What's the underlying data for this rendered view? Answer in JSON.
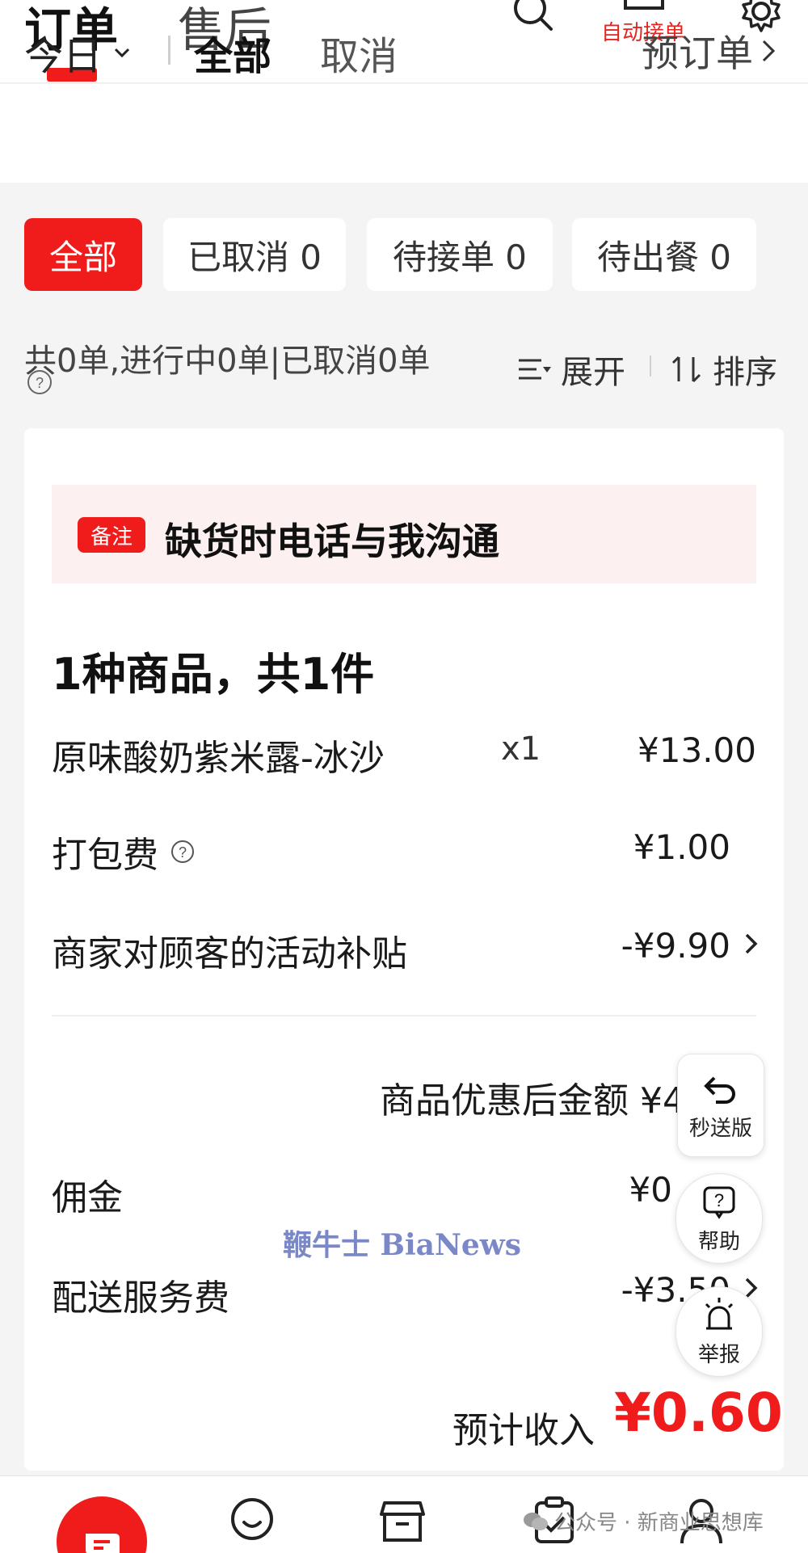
{
  "header": {
    "tabs": [
      "订单",
      "售后"
    ],
    "active_tab": "订单",
    "auto_accept_label": "自动接单",
    "icons": [
      "search-icon",
      "store-icon",
      "gear-icon"
    ],
    "accent_color": "#f01c1c"
  },
  "filter_bar": {
    "date_label": "今日",
    "options": [
      "全部",
      "取消"
    ],
    "active_option": "全部",
    "preorder_label": "预订单"
  },
  "status_chips": [
    {
      "label": "全部",
      "active": true
    },
    {
      "label": "已取消 0",
      "active": false
    },
    {
      "label": "待接单 0",
      "active": false
    },
    {
      "label": "待出餐 0",
      "active": false
    }
  ],
  "summary": {
    "text": "共0单,进行中0单|已取消0单",
    "expand_label": "展开",
    "sort_label": "排序"
  },
  "order": {
    "note_badge": "备注",
    "note_text": "缺货时电话与我沟通",
    "goods_heading": "1种商品，共1件",
    "item_name": "原味酸奶紫米露-冰沙",
    "item_qty": "x1",
    "item_price": "¥13.00",
    "packing_fee_label": "打包费",
    "packing_fee_value": "¥1.00",
    "merchant_subsidy_label": "商家对顾客的活动补贴",
    "merchant_subsidy_value": "-¥9.90",
    "discounted_total": "商品优惠后金额 ¥4.10",
    "commission_label": "佣金",
    "commission_value": "¥0",
    "delivery_fee_label": "配送服务费",
    "delivery_fee_value": "-¥3.50",
    "est_income_label": "预计收入",
    "est_income_value": "¥0.60"
  },
  "floating": {
    "express_label": "秒送版",
    "help_label": "帮助",
    "report_label": "举报"
  },
  "watermarks": {
    "bianews": "鞭牛士 BiaNews",
    "wechat": "公众号 · 新商业思想库"
  },
  "bottom_nav": {
    "icons": [
      "orders-icon",
      "chat-icon",
      "shop-icon",
      "clipboard-icon",
      "profile-icon"
    ]
  }
}
